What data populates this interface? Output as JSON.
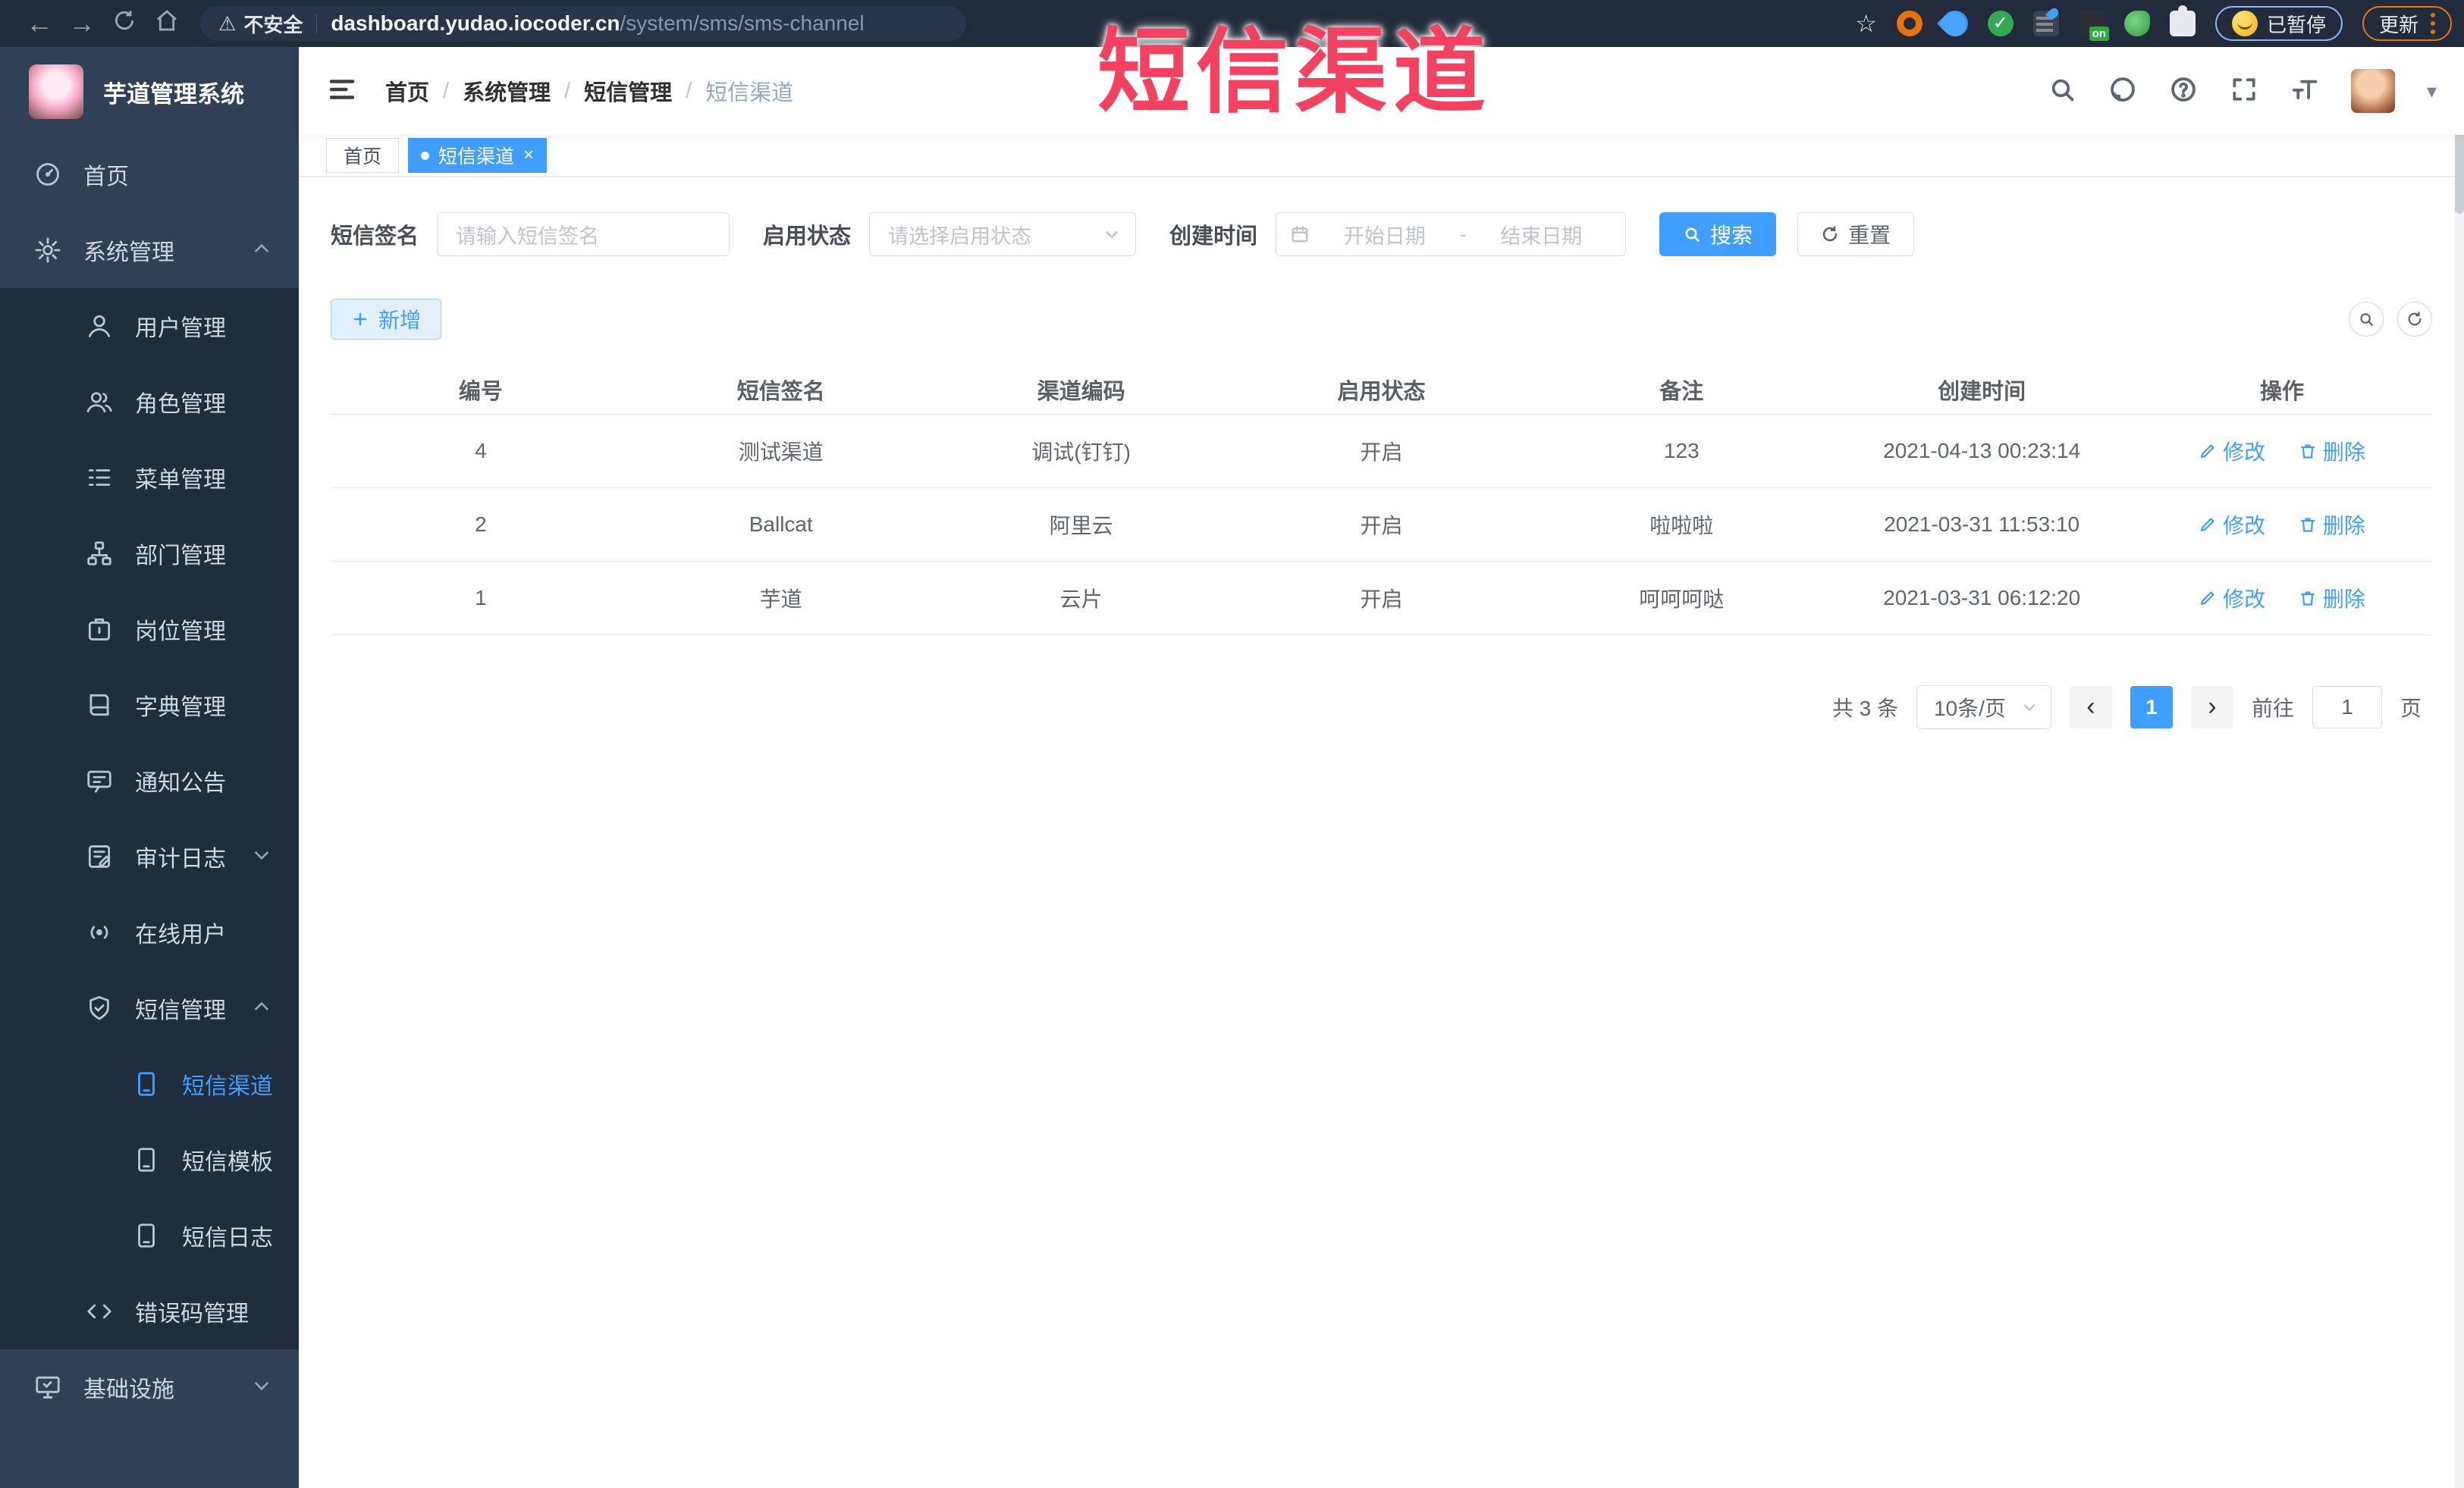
{
  "browser": {
    "insecure_label": "不安全",
    "url_host": "dashboard.yudao.iocoder.cn",
    "url_path": "/system/sms/sms-channel",
    "paused_label": "已暂停",
    "update_label": "更新"
  },
  "annotation": {
    "title": "短信渠道",
    "color": "#f4415f"
  },
  "sidebar": {
    "logo_title": "芋道管理系统",
    "items": [
      {
        "label": "首页"
      },
      {
        "label": "系统管理"
      },
      {
        "label": "用户管理"
      },
      {
        "label": "角色管理"
      },
      {
        "label": "菜单管理"
      },
      {
        "label": "部门管理"
      },
      {
        "label": "岗位管理"
      },
      {
        "label": "字典管理"
      },
      {
        "label": "通知公告"
      },
      {
        "label": "审计日志"
      },
      {
        "label": "在线用户"
      },
      {
        "label": "短信管理"
      },
      {
        "label": "短信渠道",
        "active": true
      },
      {
        "label": "短信模板"
      },
      {
        "label": "短信日志"
      },
      {
        "label": "错误码管理"
      },
      {
        "label": "基础设施"
      }
    ]
  },
  "breadcrumb": {
    "separator": "/",
    "items": [
      "首页",
      "系统管理",
      "短信管理",
      "短信渠道"
    ]
  },
  "tabs": {
    "home": "首页",
    "current": "短信渠道",
    "close": "×"
  },
  "icons": [
    "back-arrow",
    "forward-arrow",
    "reload",
    "home",
    "warning",
    "star",
    "search",
    "github",
    "help",
    "fullscreen",
    "font-size",
    "caret-down",
    "calendar",
    "refresh",
    "plus",
    "edit-pencil",
    "trash"
  ],
  "search": {
    "sign_label": "短信签名",
    "sign_placeholder": "请输入短信签名",
    "status_label": "启用状态",
    "status_placeholder": "请选择启用状态",
    "time_label": "创建时间",
    "start_placeholder": "开始日期",
    "range_separator": "-",
    "end_placeholder": "结束日期",
    "search_button": "搜索",
    "reset_button": "重置"
  },
  "toolbar": {
    "add_button": "新增"
  },
  "table": {
    "columns": [
      "编号",
      "短信签名",
      "渠道编码",
      "启用状态",
      "备注",
      "创建时间",
      "操作"
    ],
    "edit_label": "修改",
    "delete_label": "删除",
    "rows": [
      {
        "id": "4",
        "sign": "测试渠道",
        "code": "调试(钉钉)",
        "status": "开启",
        "remark": "123",
        "created": "2021-04-13 00:23:14"
      },
      {
        "id": "2",
        "sign": "Ballcat",
        "code": "阿里云",
        "status": "开启",
        "remark": "啦啦啦",
        "created": "2021-03-31 11:53:10"
      },
      {
        "id": "1",
        "sign": "芋道",
        "code": "云片",
        "status": "开启",
        "remark": "呵呵呵哒",
        "created": "2021-03-31 06:12:20"
      }
    ]
  },
  "pagination": {
    "total": "共 3 条",
    "page_size": "10条/页",
    "prev": "‹",
    "next": "›",
    "current_page": "1",
    "goto_label": "前往",
    "goto_value": "1",
    "page_unit": "页"
  }
}
